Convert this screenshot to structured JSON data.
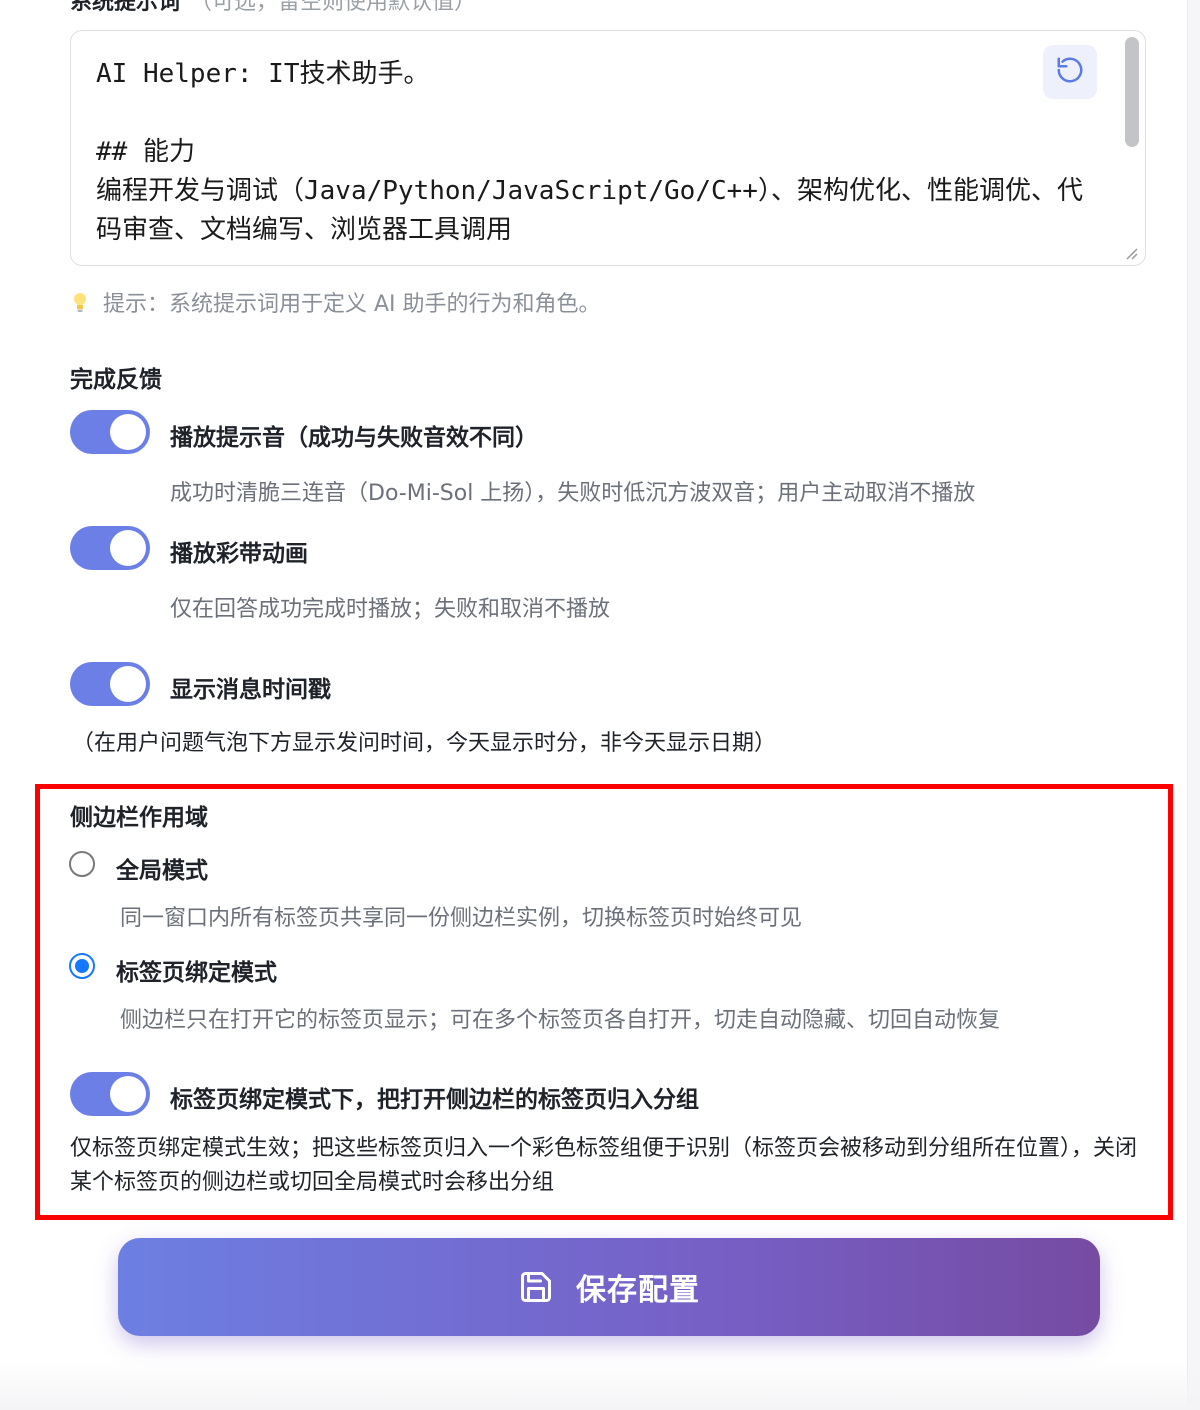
{
  "system_prompt": {
    "label": "系统提示词",
    "label_note": "（可选，留空则使用默认值）",
    "value": "AI Helper: IT技术助手。\n\n## 能力\n编程开发与调试（Java/Python/JavaScript/Go/C++）、架构优化、性能调优、代码审查、文档编写、浏览器工具调用",
    "reset_icon": "reset-icon",
    "hint_icon": "lightbulb-icon",
    "hint": "提示：系统提示词用于定义 AI 助手的行为和角色。"
  },
  "completion_feedback": {
    "title": "完成反馈",
    "sound": {
      "label": "播放提示音（成功与失败音效不同）",
      "description": "成功时清脆三连音（Do-Mi-Sol 上扬），失败时低沉方波双音；用户主动取消不播放",
      "enabled": true
    },
    "confetti": {
      "label": "播放彩带动画",
      "description": "仅在回答成功完成时播放；失败和取消不播放",
      "enabled": true
    },
    "timestamp": {
      "label": "显示消息时间戳",
      "description": "（在用户问题气泡下方显示发问时间，今天显示时分，非今天显示日期）",
      "enabled": true
    }
  },
  "sidebar_scope": {
    "title": "侧边栏作用域",
    "options": [
      {
        "label": "全局模式",
        "description": "同一窗口内所有标签页共享同一份侧边栏实例，切换标签页时始终可见",
        "selected": false
      },
      {
        "label": "标签页绑定模式",
        "description": "侧边栏只在打开它的标签页显示；可在多个标签页各自打开，切走自动隐藏、切回自动恢复",
        "selected": true
      }
    ],
    "group_tabs": {
      "label": "标签页绑定模式下，把打开侧边栏的标签页归入分组",
      "description": "仅标签页绑定模式生效；把这些标签页归入一个彩色标签组便于识别（标签页会被移动到分组所在位置），关闭某个标签页的侧边栏或切回全局模式时会移出分组",
      "enabled": true
    }
  },
  "save": {
    "label": "保存配置",
    "icon": "save-icon"
  },
  "colors": {
    "toggle_on": "#6b7fe6",
    "radio_selected": "#1677ff",
    "highlight_border": "#ff0000",
    "button_gradient_start": "#6d7fe2",
    "button_gradient_end": "#764ba2"
  }
}
